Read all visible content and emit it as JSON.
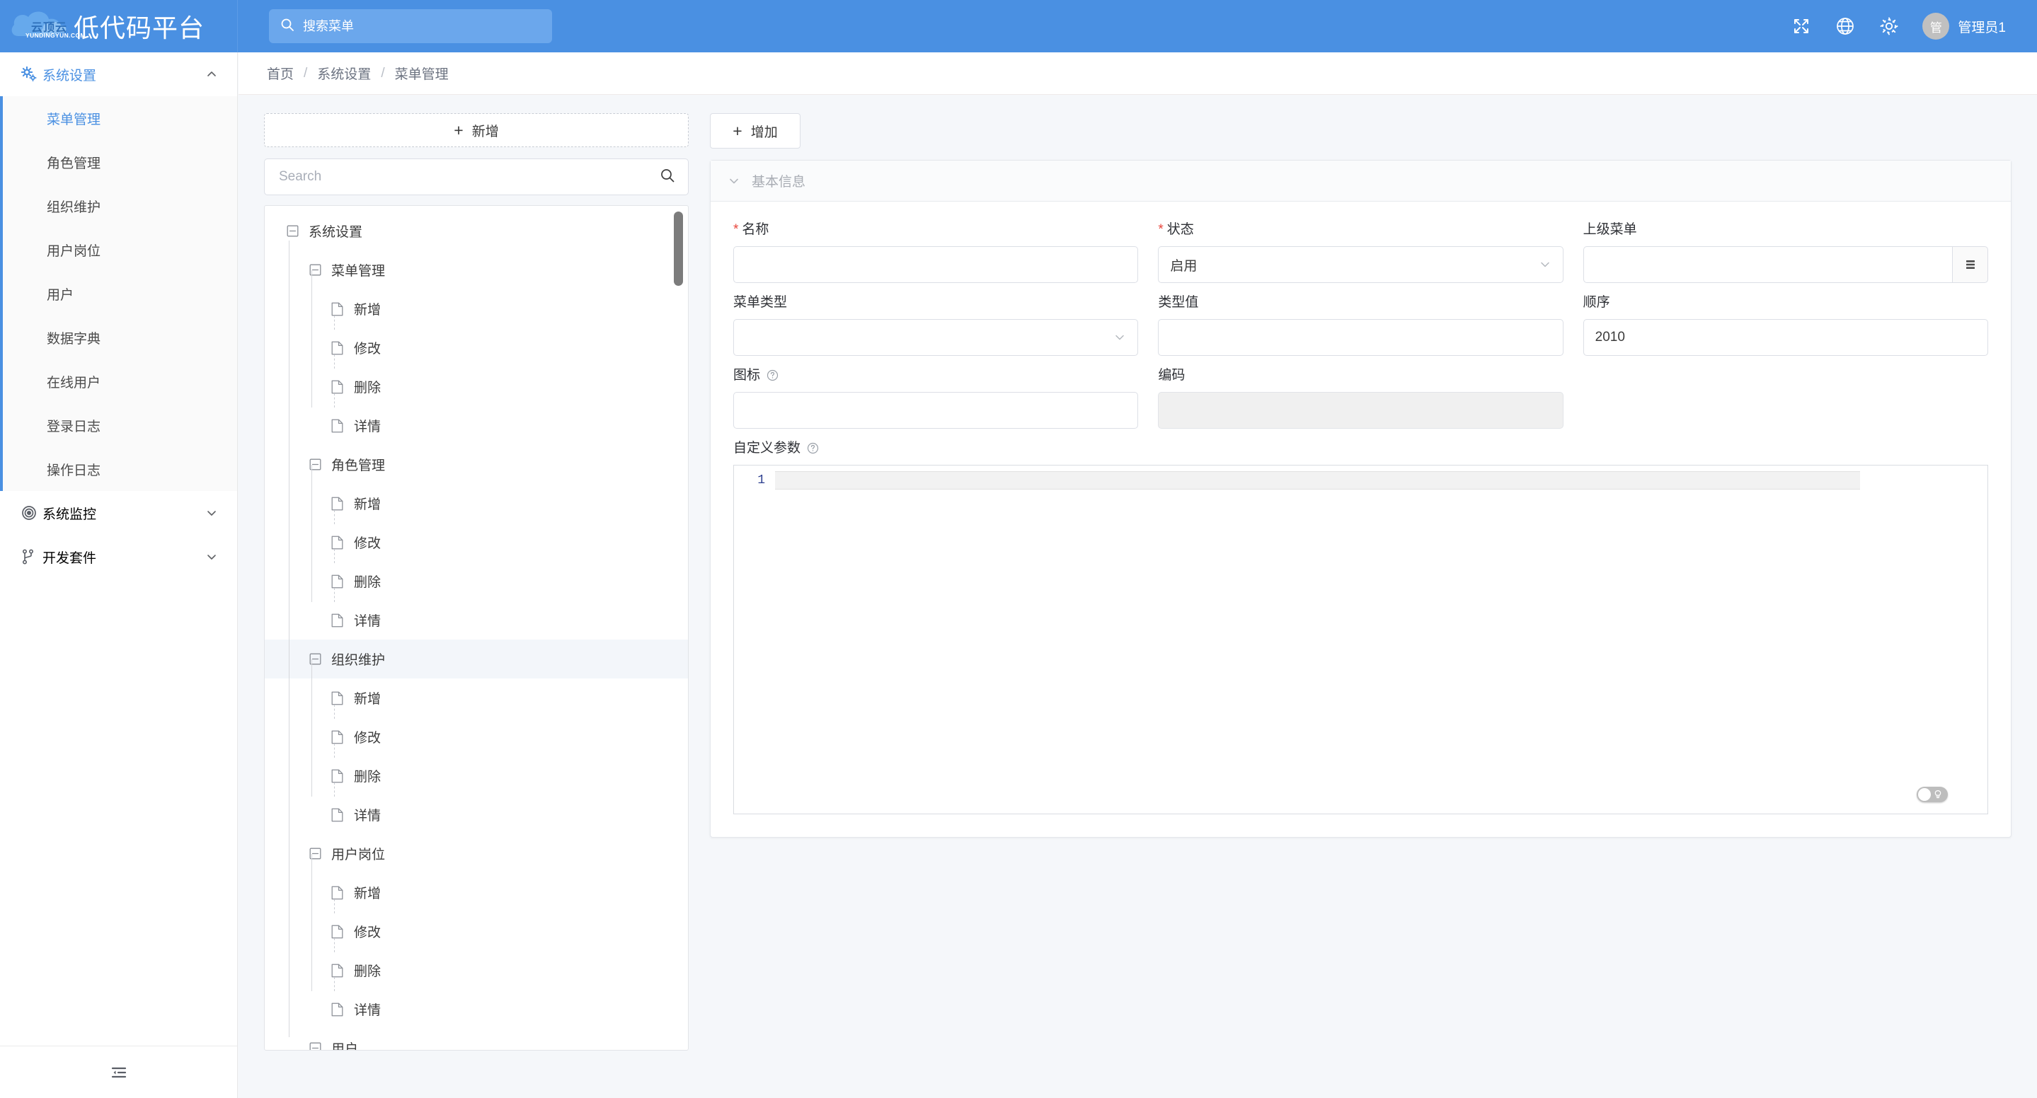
{
  "header": {
    "logo_cn": "云顶云",
    "logo_en": "YUNDINGYUN.COM",
    "logo_icon": "cloud-logo-icon",
    "title": "低代码平台",
    "search_placeholder": "搜索菜单",
    "search_value": "",
    "search_icon": "search-icon",
    "fullscreen_icon": "fullscreen-icon",
    "language_icon": "globe-icon",
    "settings_icon": "gear-icon",
    "avatar_initial": "管",
    "username": "管理员1",
    "accent_color": "#4a90e2",
    "search_bg_color": "#6ba7ec"
  },
  "sidebar": {
    "groups": [
      {
        "label": "系统设置",
        "icon": "gears-icon",
        "expanded": true,
        "arrow": "chevron-up-icon",
        "items": [
          {
            "label": "菜单管理",
            "active": true
          },
          {
            "label": "角色管理",
            "active": false
          },
          {
            "label": "组织维护",
            "active": false
          },
          {
            "label": "用户岗位",
            "active": false
          },
          {
            "label": "用户",
            "active": false
          },
          {
            "label": "数据字典",
            "active": false
          },
          {
            "label": "在线用户",
            "active": false
          },
          {
            "label": "登录日志",
            "active": false
          },
          {
            "label": "操作日志",
            "active": false
          }
        ]
      },
      {
        "label": "系统监控",
        "icon": "target-icon",
        "expanded": false,
        "arrow": "chevron-down-icon",
        "items": []
      },
      {
        "label": "开发套件",
        "icon": "branch-icon",
        "expanded": false,
        "arrow": "chevron-down-icon",
        "items": []
      }
    ],
    "collapse_icon": "menu-fold-icon"
  },
  "breadcrumb": {
    "items": [
      "首页",
      "系统设置",
      "菜单管理"
    ],
    "separator": "/"
  },
  "tree_panel": {
    "add_button_label": "新增",
    "add_button_plus": "+",
    "search_placeholder": "Search",
    "search_value": "",
    "search_icon": "search-icon",
    "expand_icon": "minus-square-icon",
    "leaf_icon": "file-icon",
    "nodes": [
      {
        "label": "系统设置",
        "level": 1,
        "type": "branch",
        "hover": false
      },
      {
        "label": "菜单管理",
        "level": 2,
        "type": "branch",
        "hover": false
      },
      {
        "label": "新增",
        "level": 3,
        "type": "leaf",
        "hover": false
      },
      {
        "label": "修改",
        "level": 3,
        "type": "leaf",
        "hover": false
      },
      {
        "label": "删除",
        "level": 3,
        "type": "leaf",
        "hover": false
      },
      {
        "label": "详情",
        "level": 3,
        "type": "leaf",
        "hover": false
      },
      {
        "label": "角色管理",
        "level": 2,
        "type": "branch",
        "hover": false
      },
      {
        "label": "新增",
        "level": 3,
        "type": "leaf",
        "hover": false
      },
      {
        "label": "修改",
        "level": 3,
        "type": "leaf",
        "hover": false
      },
      {
        "label": "删除",
        "level": 3,
        "type": "leaf",
        "hover": false
      },
      {
        "label": "详情",
        "level": 3,
        "type": "leaf",
        "hover": false
      },
      {
        "label": "组织维护",
        "level": 2,
        "type": "branch",
        "hover": true
      },
      {
        "label": "新增",
        "level": 3,
        "type": "leaf",
        "hover": false
      },
      {
        "label": "修改",
        "level": 3,
        "type": "leaf",
        "hover": false
      },
      {
        "label": "删除",
        "level": 3,
        "type": "leaf",
        "hover": false
      },
      {
        "label": "详情",
        "level": 3,
        "type": "leaf",
        "hover": false
      },
      {
        "label": "用户岗位",
        "level": 2,
        "type": "branch",
        "hover": false
      },
      {
        "label": "新增",
        "level": 3,
        "type": "leaf",
        "hover": false
      },
      {
        "label": "修改",
        "level": 3,
        "type": "leaf",
        "hover": false
      },
      {
        "label": "删除",
        "level": 3,
        "type": "leaf",
        "hover": false
      },
      {
        "label": "详情",
        "level": 3,
        "type": "leaf",
        "hover": false
      },
      {
        "label": "用户",
        "level": 2,
        "type": "branch",
        "hover": false
      }
    ]
  },
  "form": {
    "add_button_label": "增加",
    "add_button_plus": "+",
    "panel_title": "基本信息",
    "panel_chevron": "chevron-down-icon",
    "fields": {
      "name": {
        "label": "名称",
        "required": true,
        "value": "",
        "placeholder": ""
      },
      "status": {
        "label": "状态",
        "required": true,
        "value": "启用",
        "caret": "chevron-down-icon"
      },
      "parent_menu": {
        "label": "上级菜单",
        "required": false,
        "value": "",
        "picker_icon": "list-picker-icon"
      },
      "menu_type": {
        "label": "菜单类型",
        "required": false,
        "value": "",
        "caret": "chevron-down-icon"
      },
      "type_value": {
        "label": "类型值",
        "required": false,
        "value": ""
      },
      "order": {
        "label": "顺序",
        "required": false,
        "value": "2010"
      },
      "icon": {
        "label": "图标",
        "required": false,
        "value": "",
        "help_icon": "question-circle-icon"
      },
      "code": {
        "label": "编码",
        "required": false,
        "value": "",
        "disabled": true
      }
    },
    "custom_params": {
      "label": "自定义参数",
      "help_icon": "question-circle-icon",
      "line_numbers": [
        "1"
      ],
      "content": "",
      "theme_toggle_icon": "lightbulb-icon",
      "theme_toggle_on": false
    }
  }
}
